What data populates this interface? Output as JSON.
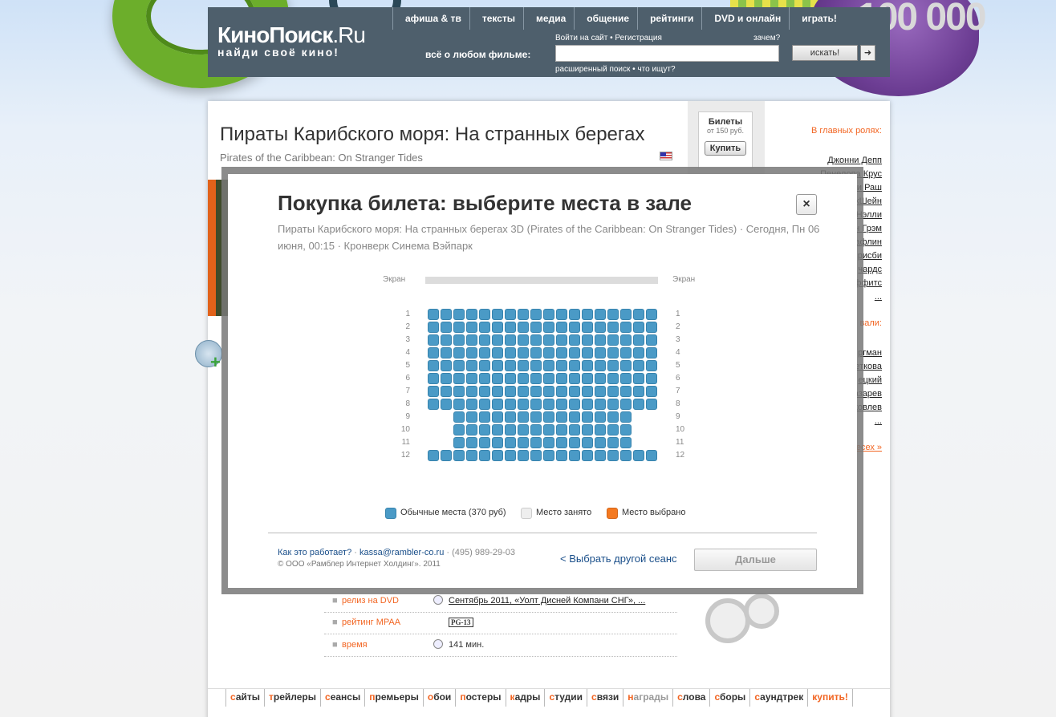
{
  "site": {
    "logo": {
      "name": "КиноПоиск",
      "domain": ".Ru",
      "tagline": "найди своё кино!"
    },
    "nav": [
      "афиша & тв",
      "тексты",
      "медиа",
      "общение",
      "рейтинги",
      "DVD и онлайн",
      "играть!"
    ],
    "promo_text": "100 000",
    "search": {
      "label": "всё о любом фильме:",
      "login": "Войти на сайт",
      "register": "Регистрация",
      "why": "зачем?",
      "button": "искать!",
      "advanced": "расширенный поиск",
      "what_search": "что ищут?"
    }
  },
  "film": {
    "title": "Пираты Карибского моря: На странных берегах",
    "original_title": "Pirates of the Caribbean: On Stranger Tides",
    "tickets": {
      "title": "Билеты",
      "price": "от 150 руб.",
      "buy": "Купить"
    },
    "roles_heading": "В главных ролях:",
    "actors": [
      "Джонни Депп",
      "Пенелопа Крус",
      "и Раш",
      "кШейн",
      "Нэлли",
      "н Грэм",
      "афлин",
      "рисби",
      "чардс",
      "ффитс",
      "..."
    ],
    "roles_heading2": "вали:",
    "actors2": [
      "ргман",
      "еткова",
      "ецкий",
      "азарев",
      "ковлев",
      "..."
    ],
    "all_link": "есех »",
    "info": [
      {
        "label": "релиз на DVD",
        "value": "Сентябрь 2011, «Уолт Дисней Компани СНГ», ...",
        "icon": "disc-icon"
      },
      {
        "label": "рейтинг MPAA",
        "value": "PG-13",
        "icon": ""
      },
      {
        "label": "время",
        "value": "141 мин.",
        "icon": "clock-icon"
      }
    ]
  },
  "modal": {
    "title": "Покупка билета: выберите места в зале",
    "close": "×",
    "subtitle": "Пираты Карибского моря: На странных берегах 3D (Pirates of the Caribbean: On Stranger Tides)  ·  Сегодня, Пн 06 июня, 00:15  ·  Кронверк Синема Вэйпарк",
    "screen_label": "Экран",
    "rows": [
      {
        "num": "1",
        "seats": 18
      },
      {
        "num": "2",
        "seats": 18
      },
      {
        "num": "3",
        "seats": 18
      },
      {
        "num": "4",
        "seats": 18
      },
      {
        "num": "5",
        "seats": 18
      },
      {
        "num": "6",
        "seats": 18
      },
      {
        "num": "7",
        "seats": 18
      },
      {
        "num": "8",
        "seats": 18
      },
      {
        "num": "9",
        "seats": 14
      },
      {
        "num": "10",
        "seats": 14
      },
      {
        "num": "11",
        "seats": 14
      },
      {
        "num": "12",
        "seats": 18
      }
    ],
    "legend": [
      {
        "label": "Обычные места (370 руб)",
        "color": "#4a9ac6"
      },
      {
        "label": "Место занято",
        "color": "#eeeeee"
      },
      {
        "label": "Место выбрано",
        "color": "#f47920"
      }
    ],
    "footer": {
      "how": "Как это работает?",
      "email": "kassa@rambler-co.ru",
      "phone": "(495) 989-29-03",
      "copyright": "© ООО «Рамблер Интернет Холдинг». 2011",
      "other_session": "< Выбрать другой сеанс",
      "next": "Дальше"
    }
  },
  "bottom_nav": [
    "сайты",
    "трейлеры",
    "сеансы",
    "премьеры",
    "обои",
    "постеры",
    "кадры",
    "студии",
    "связи",
    "награды",
    "слова",
    "сборы",
    "саундтрек",
    "купить!"
  ]
}
